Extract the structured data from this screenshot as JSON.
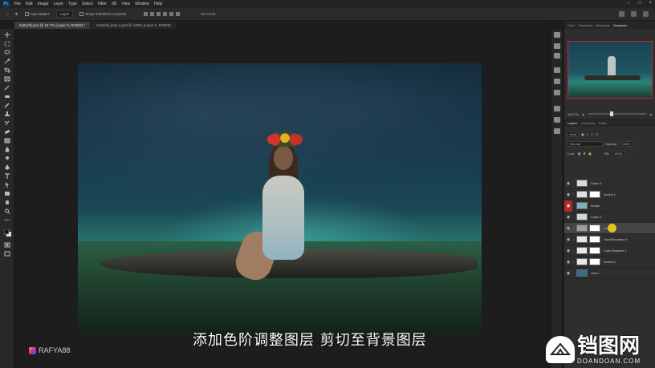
{
  "app": {
    "logo": "Ps"
  },
  "menu": [
    "File",
    "Edit",
    "Image",
    "Layer",
    "Type",
    "Select",
    "Filter",
    "3D",
    "View",
    "Window",
    "Help"
  ],
  "options": {
    "auto_select_label": "Auto-Select:",
    "auto_select_value": "Layer",
    "transform_label": "Show Transform Controls",
    "mode_3d": "3D Mode:"
  },
  "tabs": [
    "butterfly.psd @ 16.7% (Layer 0, RGB/8) *",
    "butterfly prep 1.psd @ 100% (Layer 1, RGB/8)"
  ],
  "panels": {
    "top_tabs": [
      "Color",
      "Swatches",
      "Histogram",
      "Navigator"
    ],
    "zoom": "16.67%",
    "layer_tabs": [
      "Layers",
      "Channels",
      "Paths"
    ],
    "kind_label": "Kind",
    "blend_mode": "Normal",
    "opacity_label": "Opacity:",
    "opacity_value": "100%",
    "lock_label": "Lock:",
    "fill_label": "Fill:",
    "fill_value": "100%"
  },
  "layers": [
    {
      "name": "Layer 4",
      "clipped": false,
      "selected": false,
      "eye_red": false,
      "thumb": "#d9d9d9",
      "mask": false
    },
    {
      "name": "Levels 1",
      "clipped": true,
      "selected": false,
      "eye_red": false,
      "thumb": "#e0e0e0",
      "mask": true
    },
    {
      "name": "model",
      "clipped": false,
      "selected": false,
      "eye_red": true,
      "thumb": "#7fb0c0",
      "mask": false
    },
    {
      "name": "Layer 2",
      "clipped": false,
      "selected": false,
      "eye_red": false,
      "thumb": "#cfd7d8",
      "mask": false
    },
    {
      "name": "Levels",
      "clipped": true,
      "selected": true,
      "eye_red": false,
      "thumb": "#9aa0a0",
      "mask": true
    },
    {
      "name": "Hue/Saturation 1",
      "clipped": true,
      "selected": false,
      "eye_red": false,
      "thumb": "#e8e8e8",
      "mask": true
    },
    {
      "name": "Color Balance 1",
      "clipped": true,
      "selected": false,
      "eye_red": false,
      "thumb": "#e8e8e8",
      "mask": true
    },
    {
      "name": "Levels 2",
      "clipped": true,
      "selected": false,
      "eye_red": false,
      "thumb": "#e8e8e8",
      "mask": true
    },
    {
      "name": "cloud",
      "clipped": false,
      "selected": false,
      "eye_red": false,
      "thumb": "#3a6e86",
      "mask": false
    }
  ],
  "subtitle": "添加色阶调整图层 剪切至背景图层",
  "instagram_handle": "RAFYA88",
  "watermark": {
    "cn": "铛图网",
    "en": "DOANDOAN.COM"
  },
  "colors": {
    "accent": "#31a8ff",
    "eye_red": "#b02b2b",
    "cursor": "#e6c11f"
  }
}
